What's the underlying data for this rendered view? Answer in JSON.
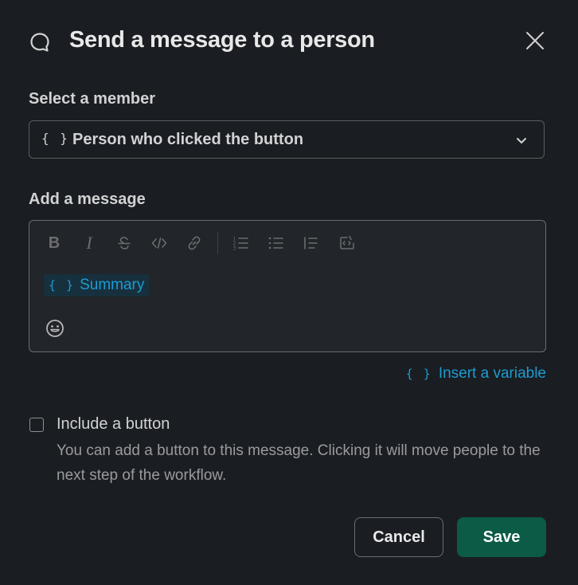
{
  "modal": {
    "title": "Send a message to a person",
    "close_icon": "close-icon",
    "header_icon": "message-bubble-icon"
  },
  "member_select": {
    "label": "Select a member",
    "variable_glyph": "{ }",
    "value": "Person who clicked the button",
    "icon": "chevron-down-icon"
  },
  "message": {
    "label": "Add a message",
    "toolbar": [
      "bold-icon",
      "italic-icon",
      "strikethrough-icon",
      "code-icon",
      "link-icon",
      "ordered-list-icon",
      "bulleted-list-icon",
      "blockquote-icon",
      "code-block-icon"
    ],
    "bold_glyph": "B",
    "italic_glyph": "I",
    "variable_chip": {
      "glyph": "{ }",
      "label": "Summary"
    },
    "emoji_icon": "emoji-icon"
  },
  "insert_variable": {
    "glyph": "{ }",
    "label": "Insert a variable"
  },
  "include_button": {
    "checked": false,
    "label": "Include a button",
    "description": "You can add a button to this message. Clicking it will move people to the next step of the workflow."
  },
  "footer": {
    "cancel_label": "Cancel",
    "save_label": "Save"
  },
  "colors": {
    "background": "#1a1d21",
    "accent_link": "#1d9bd1",
    "save_button": "#0b5b46"
  }
}
